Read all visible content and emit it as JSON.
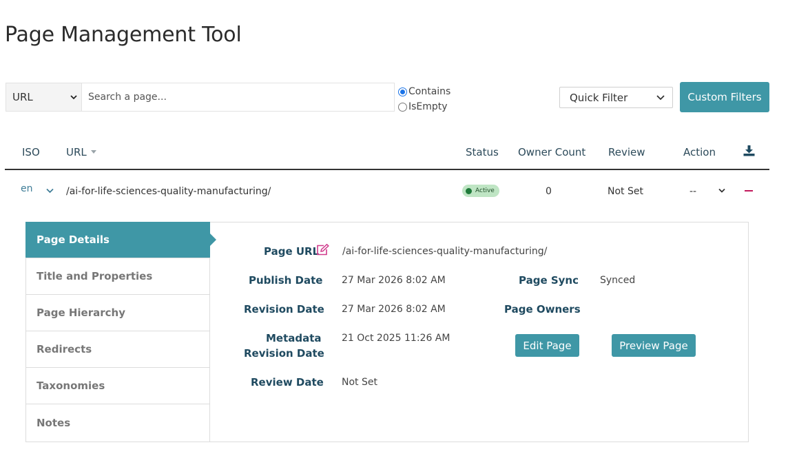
{
  "page": {
    "title": "Page Management Tool"
  },
  "search": {
    "field_selected": "URL",
    "placeholder": "Search a page...",
    "mode_options": [
      "Contains",
      "IsEmpty"
    ],
    "mode_selected": "Contains"
  },
  "filters": {
    "quick_filter_label": "Quick Filter",
    "custom_filters_label": "Custom Filters"
  },
  "table": {
    "columns": {
      "iso": "ISO",
      "url": "URL",
      "status": "Status",
      "owner_count": "Owner Count",
      "review": "Review",
      "action": "Action"
    },
    "sort_column": "URL",
    "download_icon": "download-icon",
    "row": {
      "iso": "en",
      "url": "/ai-for-life-sciences-quality-manufacturing/",
      "status": "Active",
      "owner_count": "0",
      "review": "Not Set",
      "action": "--"
    }
  },
  "details": {
    "nav": [
      "Page Details",
      "Title and Properties",
      "Page Hierarchy",
      "Redirects",
      "Taxonomies",
      "Notes"
    ],
    "active_nav": "Page Details",
    "page_url_label": "Page URL",
    "page_url": "/ai-for-life-sciences-quality-manufacturing/",
    "publish_date_label": "Publish Date",
    "publish_date": "27 Mar 2026 8:02 AM",
    "revision_date_label": "Revision Date",
    "revision_date": "27 Mar 2026 8:02 AM",
    "metadata_revision_label_1": "Metadata",
    "metadata_revision_label_2": "Revision Date",
    "metadata_revision_date": "21 Oct 2025 11:26 AM",
    "review_date_label": "Review Date",
    "review_date": "Not Set",
    "page_sync_label": "Page Sync",
    "page_sync": "Synced",
    "page_owners_label": "Page Owners",
    "edit_page_label": "Edit Page",
    "preview_page_label": "Preview Page"
  },
  "colors": {
    "accent": "#3f97a6",
    "heading_text": "#1f4a60",
    "active_badge_bg": "#bfe5c4",
    "active_dot": "#1f7a3a",
    "remove_icon": "#c2185b"
  }
}
